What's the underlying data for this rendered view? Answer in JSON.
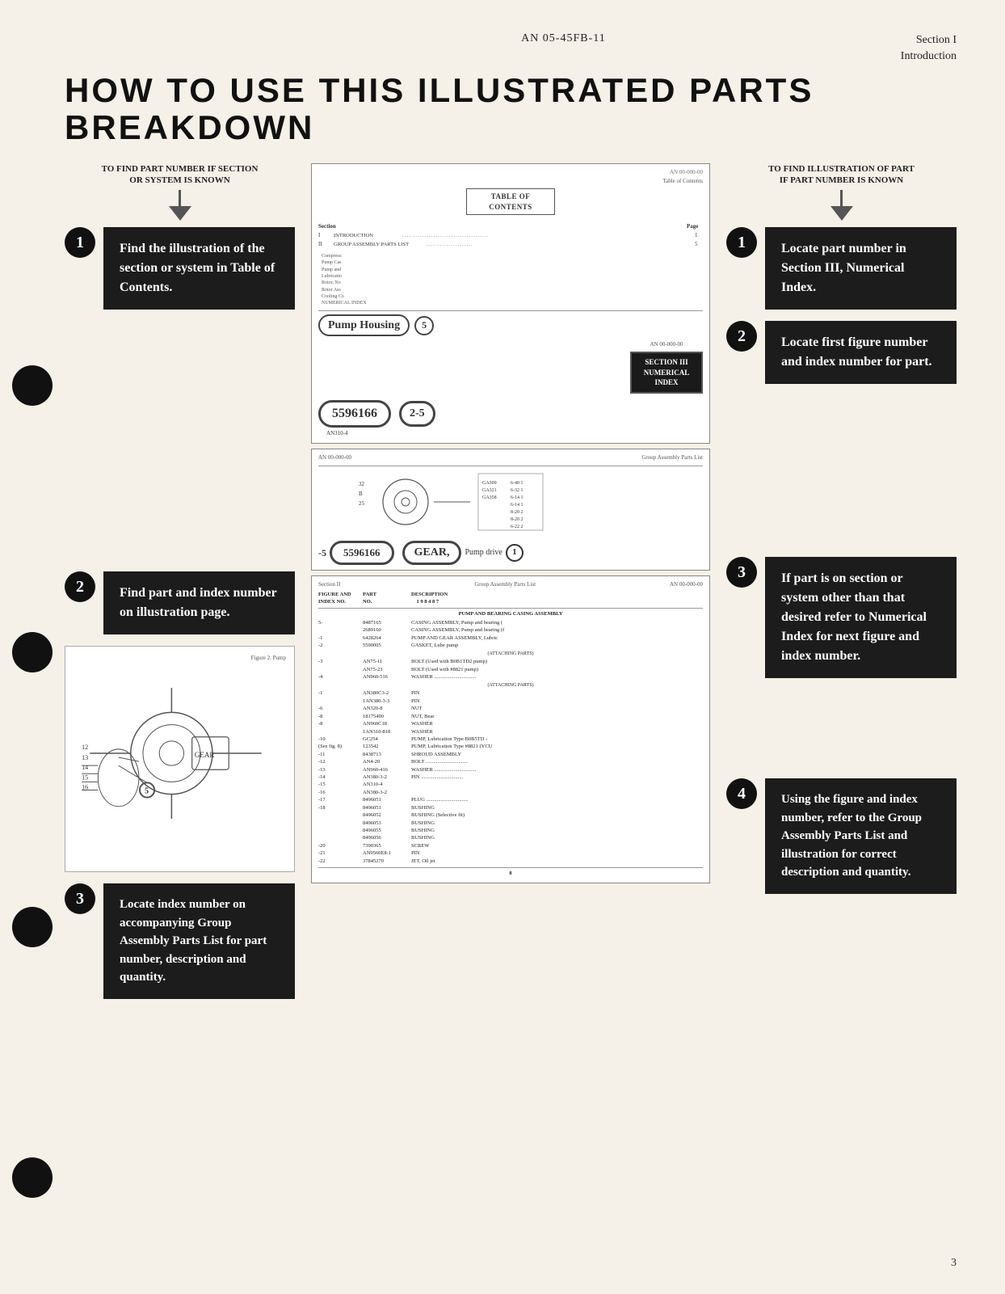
{
  "header": {
    "doc_number": "AN 05-45FB-11",
    "section_label": "Section I",
    "section_sublabel": "Introduction"
  },
  "title": "HOW TO USE THIS ILLUSTRATED PARTS BREAKDOWN",
  "left_column": {
    "subtitle": "TO FIND PART NUMBER IF SECTION\nOR SYSTEM IS KNOWN",
    "steps": [
      {
        "num": "1",
        "text": "Find the illustration of the section or system in Table of Contents."
      },
      {
        "num": "2",
        "text": "Find part and index number on illustration page."
      },
      {
        "num": "3",
        "text": "Locate index number on accompanying Group Assembly Parts List for part number, description and quantity."
      }
    ]
  },
  "right_column": {
    "subtitle": "TO FIND ILLUSTRATION OF PART\nIF PART NUMBER IS KNOWN",
    "steps": [
      {
        "num": "1",
        "text": "Locate part number in Section III, Numerical Index."
      },
      {
        "num": "2",
        "text": "Locate first figure number and index number for part."
      },
      {
        "num": "3",
        "text": "If part is on section or system other than that desired refer to Numerical Index for next figure and index number."
      },
      {
        "num": "4",
        "text": "Using the figure and index number, refer to the Group Assembly Parts List and illustration for correct description and quantity."
      }
    ]
  },
  "center_panels": {
    "toc_doc_number": "AN 00-000-00",
    "toc_label": "TABLE OF CONTENTS",
    "toc_rows": [
      {
        "section": "I",
        "title": "INTRODUCTION",
        "dots": ".....................",
        "page": "1"
      },
      {
        "section": "II",
        "title": "GROUP ASSEMBLY PARTS LIST",
        "dots": "............",
        "page": "5"
      }
    ],
    "pump_housing_label": "Pump Housing",
    "pump_housing_num": "5",
    "section_iii_label": "SECTION III\nNUMERICAL INDEX",
    "part_number_1": "5596166",
    "fig_ref": "2-5",
    "an_ref_1": "AN310-4",
    "group_assembly_doc": "AN 00-000-00",
    "group_assembly_subtitle": "Group Assembly Parts List",
    "part_number_2": "5596166",
    "gear_label": "GEAR",
    "pump_drive_label": "Pump drive",
    "index_table": [
      {
        "part": "GA309",
        "fig1": "6-40",
        "fig2": "1"
      },
      {
        "part": "GA321",
        "fig1": "6-32",
        "fig2": "1"
      },
      {
        "part": "GA358",
        "fig1": "6-14",
        "fig2": "1"
      },
      {
        "part": "",
        "fig1": "6-14",
        "fig2": "1"
      },
      {
        "part": "",
        "fig1": "8-20",
        "fig2": "2"
      },
      {
        "part": "",
        "fig1": "8-20",
        "fig2": "2"
      },
      {
        "part": "",
        "fig1": "6-22",
        "fig2": "2"
      }
    ],
    "figure_label": "Figure 2. Pump",
    "parts_list_header": {
      "section": "Section II",
      "title": "Group Assembly Parts List",
      "doc": "AN 00-000-00",
      "cols": [
        "FIGURE AND INDEX NO.",
        "PART NO.",
        "DESCRIPTION"
      ]
    },
    "parts_rows": [
      {
        "fig": "",
        "part": "",
        "desc": "PUMP AND BEARING CASING ASSEMBL"
      },
      {
        "fig": "5-",
        "part": "8487165",
        "desc": "CASING ASSEMBLY, Pump and bearing ("
      },
      {
        "fig": "",
        "part": "2689160",
        "desc": "CASING ASSEMBLY, Pump and bearing (f"
      },
      {
        "fig": "-1",
        "part": "6428264",
        "desc": "PUMP AND GEAR ASSEMBLY, Lubric"
      },
      {
        "fig": "-2",
        "part": "5590005",
        "desc": "GASKET, Lube pump"
      },
      {
        "fig": "",
        "part": "",
        "desc": "(ATTACHING PARTS)"
      },
      {
        "fig": "-3",
        "part": "AN75-11",
        "desc": "BOLT (Used with B0B1TD2 pump)"
      },
      {
        "fig": "",
        "part": "AN75-23",
        "desc": "BOLT (Used with #8821 pump)"
      },
      {
        "fig": "-4",
        "part": "AN960-516",
        "desc": "WASHER"
      },
      {
        "fig": "",
        "part": "",
        "desc": "(ATTACHING PARTS)"
      },
      {
        "fig": "-1",
        "part": "AN380C3-2",
        "desc": "PIN"
      },
      {
        "fig": "",
        "part": "1AN380-3-3",
        "desc": "PIN"
      },
      {
        "fig": "-6",
        "part": "AN320-8",
        "desc": "NUT"
      },
      {
        "fig": "-8",
        "part": "18175490",
        "desc": "NUT, Bear"
      },
      {
        "fig": "-8",
        "part": "AN960C18",
        "desc": "WASHER"
      },
      {
        "fig": "",
        "part": "1AN310-818",
        "desc": "WASHER"
      },
      {
        "fig": "-10",
        "part": "GC254",
        "desc": "PUMP, Lubrication Type B0B5TD"
      },
      {
        "fig": "",
        "part": "123542",
        "desc": "PUMP, Lubrication Type #8821 (YCU"
      },
      {
        "fig": "-11",
        "part": "8438713",
        "desc": "SHROUD ASSEMBLY"
      },
      {
        "fig": "-12",
        "part": "AN4-20",
        "desc": "BOLT"
      },
      {
        "fig": "-13",
        "part": "AN960-416",
        "desc": "WASHER"
      },
      {
        "fig": "-14",
        "part": "AN380-3-2",
        "desc": "PIN"
      },
      {
        "fig": "-15",
        "part": "AN310-4",
        "desc": ""
      },
      {
        "fig": "-16",
        "part": "AN310-3-2",
        "desc": ""
      },
      {
        "fig": "-17",
        "part": "8496051",
        "desc": "PLUG"
      },
      {
        "fig": "-18",
        "part": "8496051",
        "desc": "BUSHING"
      },
      {
        "fig": "",
        "part": "8496052",
        "desc": "BUSHING (Selective fit)"
      },
      {
        "fig": "",
        "part": "8496053",
        "desc": "BUSHING"
      },
      {
        "fig": "",
        "part": "8496055",
        "desc": "BUSHING"
      },
      {
        "fig": "",
        "part": "8496056",
        "desc": "BUSHING"
      },
      {
        "fig": "-20",
        "part": "7390365",
        "desc": "SCREW"
      },
      {
        "fig": "-21",
        "part": "AN9560E8-1",
        "desc": "PIN"
      },
      {
        "fig": "-22",
        "part": "37845270",
        "desc": "JET, Oil jet"
      }
    ]
  },
  "page_number": "3"
}
